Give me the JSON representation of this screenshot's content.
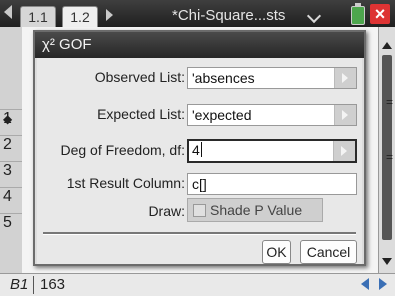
{
  "tabs": [
    {
      "label": "1.1"
    },
    {
      "label": "1.2"
    }
  ],
  "document": {
    "title": "*Chi-Square...sts"
  },
  "spreadsheet": {
    "row_numbers": [
      "1",
      "2",
      "3",
      "4",
      "5"
    ],
    "entry_line": {
      "cell_ref": "B1",
      "value": "163"
    }
  },
  "dialog": {
    "title": "χ² GOF",
    "fields": [
      {
        "label": "Observed List:",
        "value": "'absences",
        "has_dropdown": true
      },
      {
        "label": "Expected List:",
        "value": "'expected",
        "has_dropdown": true
      },
      {
        "label": "Deg of Freedom, df:",
        "value": "4",
        "has_dropdown": true,
        "focused": true
      },
      {
        "label": "1st Result Column:",
        "value": "c[]",
        "has_dropdown": false
      }
    ],
    "draw": {
      "label": "Draw:",
      "option": "Shade P Value",
      "checked": false
    },
    "buttons": {
      "ok": "OK",
      "cancel": "Cancel"
    }
  }
}
